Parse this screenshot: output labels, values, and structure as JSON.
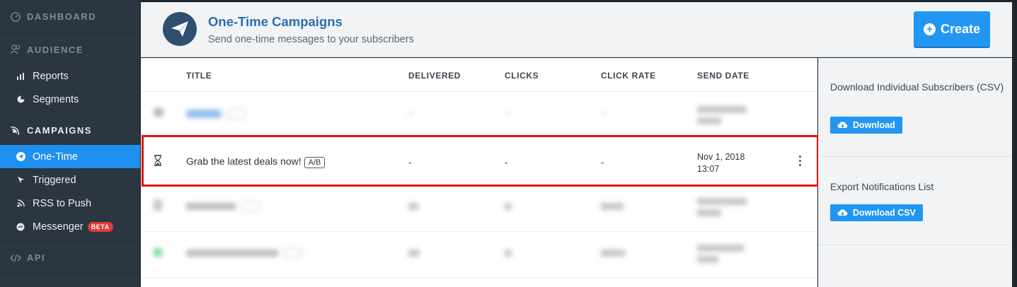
{
  "sidebar": {
    "dashboard": "DASHBOARD",
    "audience": "AUDIENCE",
    "audience_items": [
      {
        "label": "Reports",
        "icon": "bar-chart-icon"
      },
      {
        "label": "Segments",
        "icon": "pie-chart-icon"
      }
    ],
    "campaigns": "CAMPAIGNS",
    "campaign_items": [
      {
        "label": "One-Time",
        "icon": "paper-plane-icon",
        "active": true
      },
      {
        "label": "Triggered",
        "icon": "cursor-icon"
      },
      {
        "label": "RSS to Push",
        "icon": "rss-icon"
      },
      {
        "label": "Messenger",
        "icon": "messenger-icon",
        "badge": "BETA"
      }
    ],
    "api": "API"
  },
  "header": {
    "title": "One-Time Campaigns",
    "subtitle": "Send one-time messages to your subscribers",
    "create_label": "Create"
  },
  "table": {
    "columns": [
      "TITLE",
      "DELIVERED",
      "CLICKS",
      "CLICK RATE",
      "SEND DATE"
    ],
    "highlighted_row": {
      "status_icon": "hourglass-icon",
      "title": "Grab the latest deals now!",
      "tag": "A/B",
      "delivered": "-",
      "clicks": "-",
      "click_rate": "-",
      "send_date_line1": "Nov 1, 2018",
      "send_date_line2": "13:07"
    }
  },
  "panel": {
    "subscribers_label": "Download Individual Subscribers (CSV)",
    "subscribers_button": "Download",
    "notifications_label": "Export Notifications List",
    "notifications_button": "Download CSV"
  },
  "colors": {
    "accent": "#2196f3",
    "sidebar_bg": "#2b3640",
    "highlight": "#e3160b",
    "title_blue": "#2a6fb0"
  }
}
